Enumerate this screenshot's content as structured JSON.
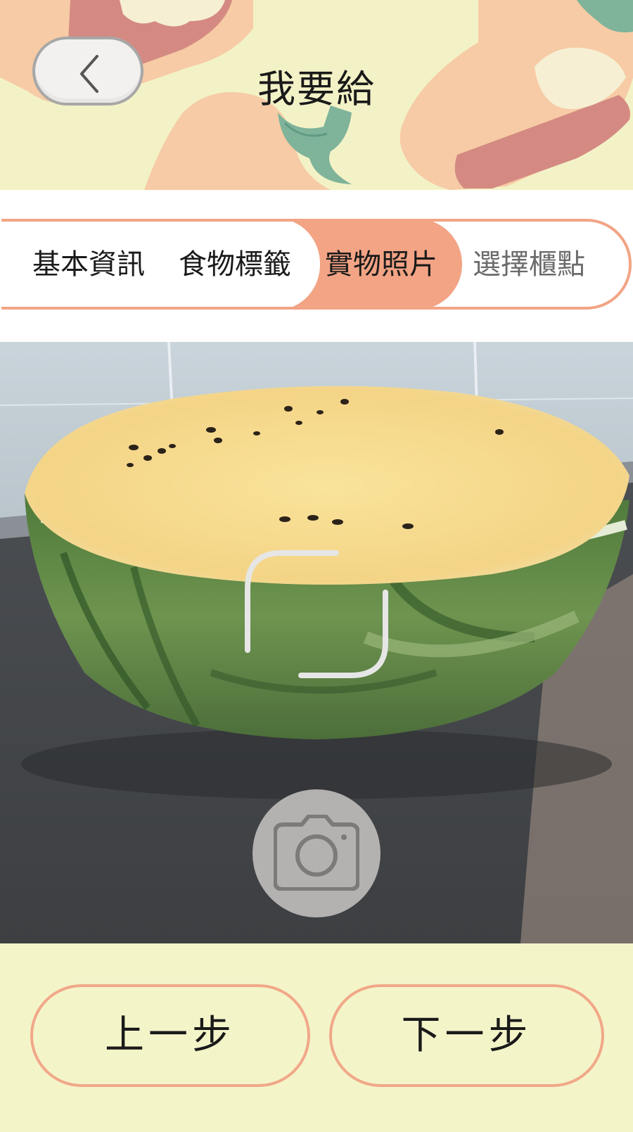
{
  "header": {
    "title": "我要給",
    "back_icon": "chevron-left-icon"
  },
  "steps": {
    "items": [
      {
        "label": "基本資訊",
        "state": "done"
      },
      {
        "label": "食物標籤",
        "state": "done"
      },
      {
        "label": "實物照片",
        "state": "active"
      },
      {
        "label": "選擇櫃點",
        "state": "pending"
      }
    ]
  },
  "camera": {
    "shutter_icon": "camera-icon",
    "focus_icon": "focus-frame-icon"
  },
  "footer": {
    "prev_label": "上一步",
    "next_label": "下一步"
  },
  "colors": {
    "accent": "#f2a485",
    "background": "#f4f4c9",
    "header_background": "#f3f2c7"
  }
}
